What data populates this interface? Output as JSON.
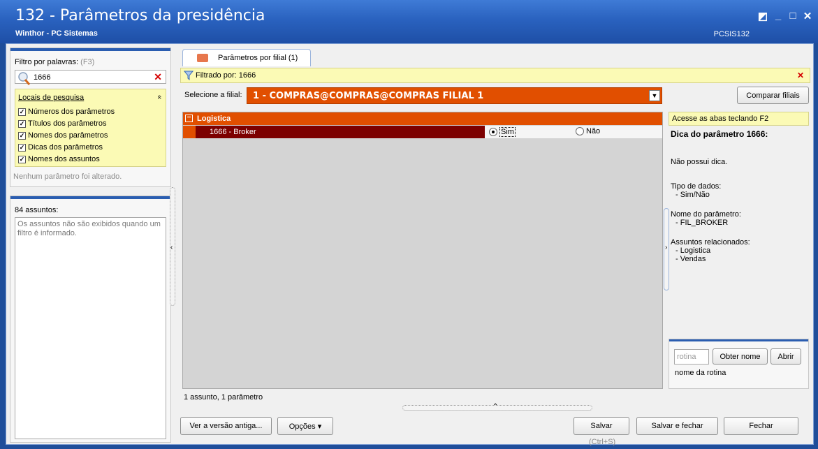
{
  "window": {
    "title": "132 - Parâmetros da presidência",
    "subtitle": "Winthor - PC Sistemas",
    "code": "PCSIS132",
    "controls": {
      "restore": "◩",
      "minimize": "_",
      "maximize": "□",
      "close": "✕"
    }
  },
  "filter": {
    "label": "Filtro por palavras:",
    "shortcut": "(F3)",
    "value": "1666",
    "clear_icon": "✕",
    "locais": {
      "title": "Locais de pesquisa",
      "collapse_icon": "«",
      "items": [
        {
          "label": "Números dos parâmetros",
          "checked": true
        },
        {
          "label": "Títulos dos parâmetros",
          "checked": true
        },
        {
          "label": "Nomes dos parâmetros",
          "checked": true
        },
        {
          "label": "Dicas dos parâmetros",
          "checked": true
        },
        {
          "label": "Nomes dos assuntos",
          "checked": true
        }
      ]
    },
    "no_change": "Nenhum parâmetro foi alterado."
  },
  "assuntos": {
    "title": "84 assuntos:",
    "message": "Os assuntos não são exibidos quando um filtro é informado."
  },
  "tab": {
    "label": "Parâmetros por filial (1)"
  },
  "filtered": {
    "text": "Filtrado por: 1666",
    "close_icon": "✕"
  },
  "filial": {
    "label": "Selecione a filial:",
    "value": "1 - COMPRAS@COMPRAS@COMPRAS FILIAL 1",
    "compare_button": "Comparar filiais"
  },
  "grid": {
    "group": "Logistica",
    "rows": [
      {
        "name": "1666 - Broker",
        "options": [
          {
            "label": "Sim",
            "selected": true
          },
          {
            "label": "Não",
            "selected": false
          }
        ]
      }
    ]
  },
  "status": "1 assunto, 1 parâmetro",
  "right": {
    "hint": "Acesse as abas teclando F2",
    "heading": "Dica do parâmetro 1666:",
    "no_tip": "Não possui dica.",
    "tipo_label": "Tipo de dados:",
    "tipo_value": "- Sim/Não",
    "nome_label": "Nome do parâmetro:",
    "nome_value": "- FIL_BROKER",
    "assuntos_label": "Assuntos relacionados:",
    "assuntos_values": [
      "- Logistica",
      "- Vendas"
    ]
  },
  "rotina": {
    "placeholder": "rotina",
    "obter_button": "Obter nome",
    "abrir_button": "Abrir",
    "name_label": "nome da rotina"
  },
  "bottom": {
    "versao_button": "Ver a versão antiga...",
    "opcoes_button": "Opções ▾",
    "salvar_button": "Salvar",
    "salvar_shortcut": "(Ctrl+S)",
    "salvar_fechar_button": "Salvar e fechar",
    "fechar_button": "Fechar"
  }
}
